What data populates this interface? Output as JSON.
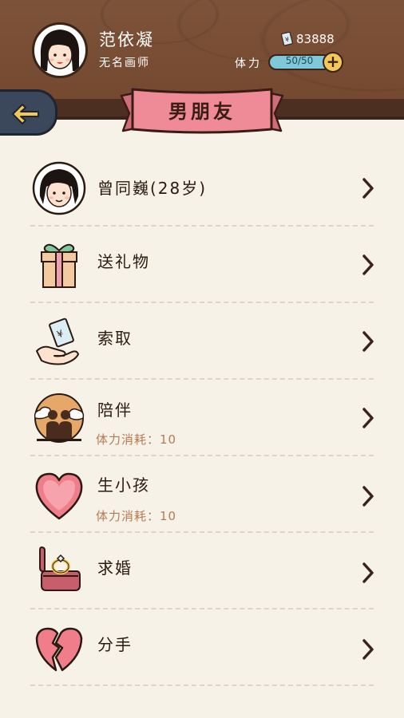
{
  "header": {
    "player_name": "范依凝",
    "player_title": "无名画师",
    "currency_icon": "banknote-icon",
    "currency_value": "83888",
    "stamina_label": "体力",
    "stamina_text": "50/50",
    "stamina_fraction": 1.0,
    "plus_label": "+"
  },
  "page": {
    "title": "男朋友",
    "back_icon": "arrow-left-icon"
  },
  "menu": [
    {
      "icon": "boyfriend-avatar-icon",
      "label": "曾同巍(28岁)",
      "cost": ""
    },
    {
      "icon": "gift-box-icon",
      "label": "送礼物",
      "cost": ""
    },
    {
      "icon": "money-in-hand-icon",
      "label": "索取",
      "cost": ""
    },
    {
      "icon": "couple-silhouette-icon",
      "label": "陪伴",
      "cost": "体力消耗：10"
    },
    {
      "icon": "heart-icon",
      "label": "生小孩",
      "cost": "体力消耗：10"
    },
    {
      "icon": "ring-box-icon",
      "label": "求婚",
      "cost": ""
    },
    {
      "icon": "broken-heart-icon",
      "label": "分手",
      "cost": ""
    }
  ],
  "colors": {
    "header_wood": "#7a5038",
    "background": "#f6f2e7",
    "ribbon": "#ef8b97",
    "back_button": "#3b475a",
    "accent_gold": "#f3c85a",
    "stamina_fill": "#7ec8d8",
    "cost_text": "#b77a52"
  }
}
